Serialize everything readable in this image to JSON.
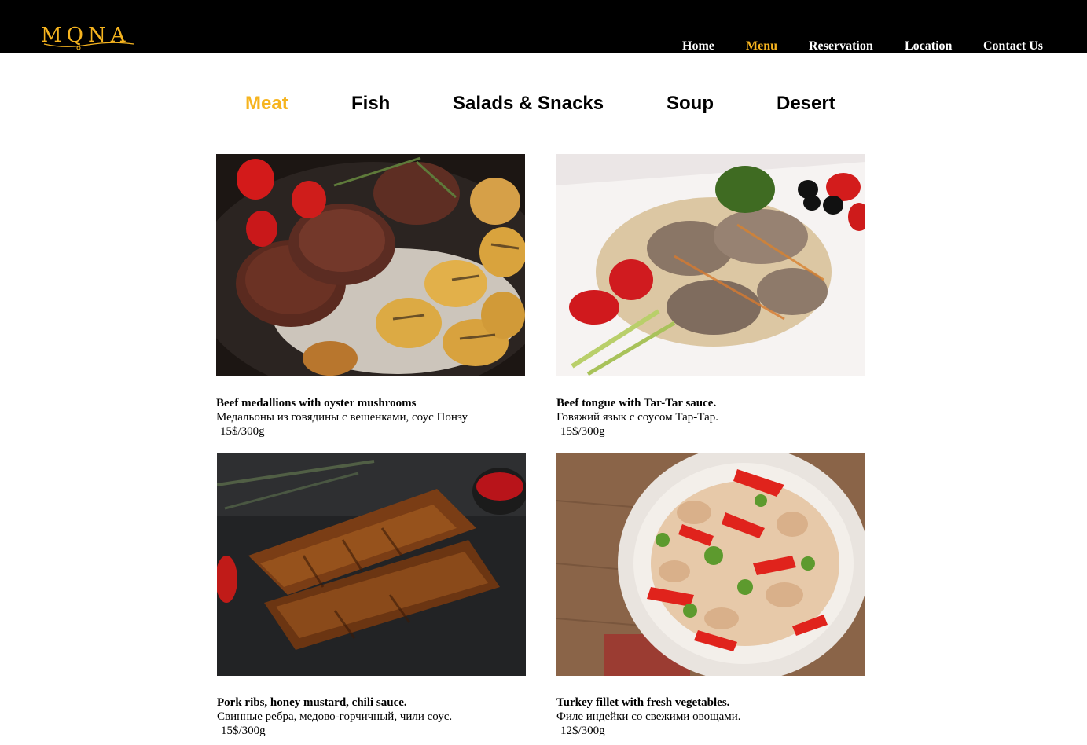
{
  "brand": {
    "logo_text": "MQNA",
    "accent_color": "#f6b41f"
  },
  "nav": {
    "items": [
      {
        "label": "Home"
      },
      {
        "label": "Menu",
        "active": true
      },
      {
        "label": "Reservation"
      },
      {
        "label": "Location"
      },
      {
        "label": "Contact Us"
      }
    ]
  },
  "categories": [
    {
      "label": "Meat",
      "active": true
    },
    {
      "label": "Fish"
    },
    {
      "label": "Salads & Snacks"
    },
    {
      "label": "Soup"
    },
    {
      "label": "Desert"
    }
  ],
  "dishes": [
    {
      "name": "Beef medallions with oyster mushrooms",
      "description": "Медальоны из говядины с вешенками, соус Понзу",
      "price": "15$/300g",
      "image": "steak-potatoes-photo"
    },
    {
      "name": "Beef tongue with Tar-Tar sauce.",
      "description": "Говяжий язык с соусом Тар-Тар.",
      "price": "15$/300g",
      "image": "beef-tongue-sauce-photo"
    },
    {
      "name": "Pork ribs, honey mustard, chili sauce.",
      "description": "Свинные ребра, медово-горчичный, чили соус.",
      "price": "15$/300g",
      "image": "pork-ribs-photo"
    },
    {
      "name": "Turkey fillet with fresh vegetables.",
      "description": "Филе индейки со свежими овощами.",
      "price": "12$/300g",
      "image": "turkey-vegetables-photo"
    }
  ]
}
